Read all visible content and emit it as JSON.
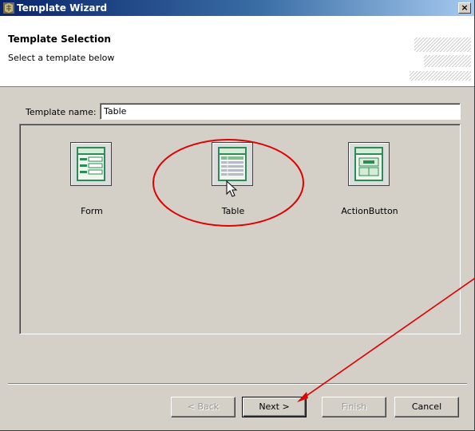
{
  "window": {
    "title": "Template Wizard",
    "close_label": "×"
  },
  "header": {
    "title": "Template Selection",
    "subtitle": "Select a template below"
  },
  "template_name": {
    "label": "Template name:",
    "value": "Table"
  },
  "templates": [
    {
      "label": "Form",
      "icon": "form-template-icon"
    },
    {
      "label": "Table",
      "icon": "table-template-icon",
      "selected": true
    },
    {
      "label": "ActionButton",
      "icon": "action-button-template-icon"
    }
  ],
  "buttons": {
    "back": {
      "label": "< Back",
      "enabled": false
    },
    "next": {
      "label": "Next >",
      "enabled": true,
      "default": true
    },
    "finish": {
      "label": "Finish",
      "enabled": false
    },
    "cancel": {
      "label": "Cancel",
      "enabled": true
    }
  },
  "colors": {
    "dialog_face": "#d4d0c8",
    "title_bar_start": "#0a246a",
    "icon_green": "#2e8b57",
    "annotation_red": "#e00000"
  }
}
